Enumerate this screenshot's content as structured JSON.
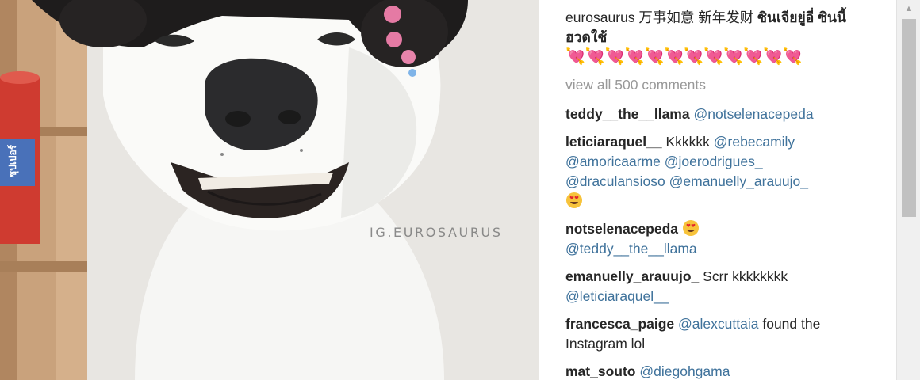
{
  "photo": {
    "watermark": "IG.EUROSAURUS",
    "can_label": "ซุปเปอร์"
  },
  "caption": {
    "user": "eurosaurus",
    "text": " 万事如意 新年发财 ",
    "thai": "ซินเจียยู่อี่ ซินนี้ฮวดใช้",
    "hearts": "💘💘💘💘💘💘💘💘💘💘💘💘"
  },
  "view_all": "view all 500 comments",
  "comments": [
    {
      "user": "teddy__the__llama",
      "mentions": [
        "@notselenacepeda"
      ]
    },
    {
      "user": "leticiaraquel__",
      "text": "Kkkkkk",
      "mentions": [
        "@rebecamily",
        "@amoricaarme",
        "@joerodrigues_",
        "@draculansioso",
        "@emanuelly_arauujo_"
      ]
    },
    {
      "user": "notselenacepeda",
      "mentions": [
        "@teddy__the__llama"
      ]
    },
    {
      "user": "emanuelly_arauujo_",
      "text": "Scrr kkkkkkkk",
      "mentions": [
        "@leticiaraquel__"
      ]
    },
    {
      "user": "francesca_paige",
      "mention": "@alexcuttaia",
      "text": "found the Instagram lol"
    },
    {
      "user": "mat_souto",
      "mention": "@diegohgama"
    }
  ],
  "icons": [
    "heart-eyes-emoji",
    "scroll-up-arrow"
  ],
  "colors": {
    "mention": "#3f729b",
    "muted": "#999999",
    "text": "#262626"
  }
}
